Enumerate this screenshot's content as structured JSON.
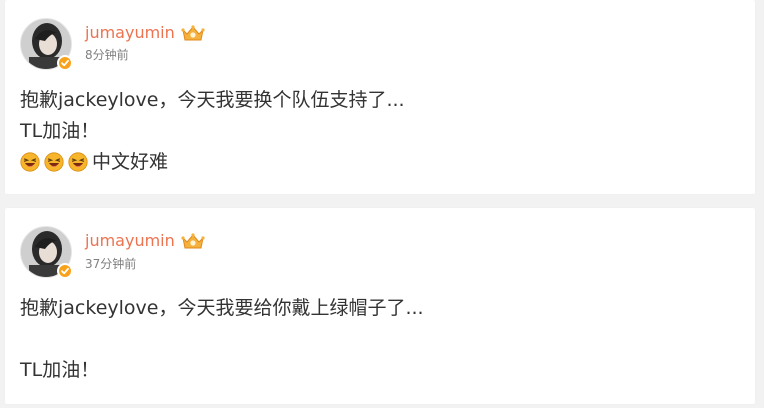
{
  "posts": [
    {
      "username": "jumayumin",
      "time": "8分钟前",
      "lines": [
        "抱歉jackeylove，今天我要换个队伍支持了...",
        "TL加油！"
      ],
      "emoji_line_text": "中文好难",
      "emoji_icons": [
        "laughing-face-icon",
        "laughing-face-icon",
        "laughing-face-icon"
      ]
    },
    {
      "username": "jumayumin",
      "time": "37分钟前",
      "lines": [
        "抱歉jackeylove，今天我要给你戴上绿帽子了...",
        "TL加油！"
      ]
    }
  ],
  "colors": {
    "username": "#eb7350",
    "text": "#333333",
    "time": "#808080",
    "verified_badge": "#f7a21a",
    "background": "#f2f2f2"
  }
}
